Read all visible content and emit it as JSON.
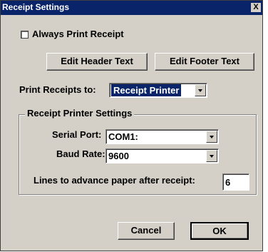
{
  "window": {
    "title": "Receipt Settings",
    "close_label": "X"
  },
  "always_print": {
    "label": "Always Print Receipt",
    "checked": false
  },
  "buttons": {
    "edit_header": "Edit Header Text",
    "edit_footer": "Edit Footer Text",
    "cancel": "Cancel",
    "ok": "OK"
  },
  "print_to": {
    "label": "Print Receipts to:",
    "value": "Receipt Printer"
  },
  "printer_settings": {
    "group_title": "Receipt Printer Settings",
    "serial_port_label": "Serial Port:",
    "serial_port_value": "COM1:",
    "baud_rate_label": "Baud Rate:",
    "baud_rate_value": "9600",
    "lines_label": "Lines to advance paper after receipt:",
    "lines_value": "6"
  }
}
